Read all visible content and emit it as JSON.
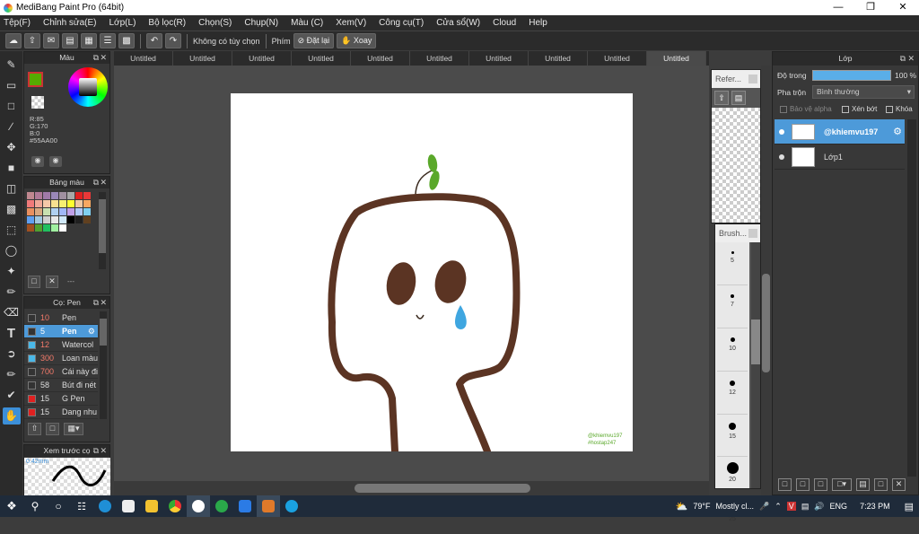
{
  "window": {
    "title": "MediBang Paint Pro (64bit)"
  },
  "menu": [
    "Tệp(F)",
    "Chỉnh sửa(E)",
    "Lớp(L)",
    "Bộ lọc(R)",
    "Chọn(S)",
    "Chụp(N)",
    "Màu (C)",
    "Xem(V)",
    "Công cụ(T)",
    "Cửa sổ(W)",
    "Cloud",
    "Help"
  ],
  "toolbar": {
    "no_option": "Không có tùy chọn",
    "keys_label": "Phím",
    "reset_label": "Đặt lại",
    "rotate_label": "Xoay"
  },
  "color_panel": {
    "title": "Màu",
    "r": "R:85",
    "g": "G:170",
    "b": "B:0",
    "hex": "#55AA00",
    "fg_color": "#55AA00",
    "bg_color": "#ffffff"
  },
  "palette_panel": {
    "title": "Bảng màu",
    "dash": "---",
    "colors": [
      "#c08890",
      "#b07a98",
      "#a07aa8",
      "#9a88b8",
      "#a090a0",
      "#a8a8a8",
      "#e02020",
      "#e83838",
      "#f07a7a",
      "#f0a898",
      "#f5c8a8",
      "#f8e090",
      "#f8f070",
      "#ffff30",
      "#f0c8a0",
      "#f8a860",
      "#e89060",
      "#d8a880",
      "#c8e0b0",
      "#b0d0f0",
      "#a0b8f8",
      "#c0a0e8",
      "#b0c8f8",
      "#80d0f0",
      "#60a0f0",
      "#a0c8e0",
      "#d0d0d0",
      "#e8e8e8",
      "#d0e8f8",
      "#000000",
      "#202020",
      "#604020",
      "#a05020",
      "#50a030",
      "#20c060",
      "#a0f0a0",
      "#ffffff"
    ]
  },
  "brush_panel": {
    "title": "Cọ: Pen",
    "items": [
      {
        "size": "10",
        "name": "Pen",
        "color": "#333333"
      },
      {
        "size": "5",
        "name": "Pen",
        "color": "#333333"
      },
      {
        "size": "12",
        "name": "Watercol",
        "color": "#4ab8e8"
      },
      {
        "size": "300",
        "name": "Loan màu",
        "color": "#4ab8e8"
      },
      {
        "size": "700",
        "name": "Cái này đi",
        "color": "#333333"
      },
      {
        "size": "58",
        "name": "Bút đi nét",
        "color": "#333333"
      },
      {
        "size": "15",
        "name": "G Pen",
        "color": "#e02020"
      },
      {
        "size": "15",
        "name": "Dang nhu",
        "color": "#e02020"
      }
    ]
  },
  "preview_panel": {
    "title": "Xem trước cọ",
    "size": "0.42mm"
  },
  "tabs": [
    "Untitled",
    "Untitled",
    "Untitled",
    "Untitled",
    "Untitled",
    "Untitled",
    "Untitled",
    "Untitled",
    "Untitled",
    "Untitled"
  ],
  "canvas": {
    "watermark_1": "@khiemvu197",
    "watermark_2": "#hostap247"
  },
  "reference_panel": {
    "title": "Refer..."
  },
  "brush_size_panel": {
    "title": "Brush...",
    "sizes": [
      "5",
      "7",
      "10",
      "12",
      "15",
      "20",
      "25"
    ]
  },
  "layer_panel": {
    "title": "Lớp",
    "opacity_label": "Độ trong",
    "opacity_value": "100 %",
    "blend_label": "Pha trộn",
    "blend_value": "Bình thường",
    "protect_alpha": "Bảo vệ alpha",
    "clipping": "Xén bớt",
    "lock": "Khóa",
    "layers": [
      {
        "name": "@khiemvu197",
        "selected": true
      },
      {
        "name": "Lớp1",
        "selected": false
      }
    ]
  },
  "taskbar": {
    "weather_temp": "79°F",
    "weather_text": "Mostly cl...",
    "lang": "ENG",
    "time": "7:23 PM"
  }
}
